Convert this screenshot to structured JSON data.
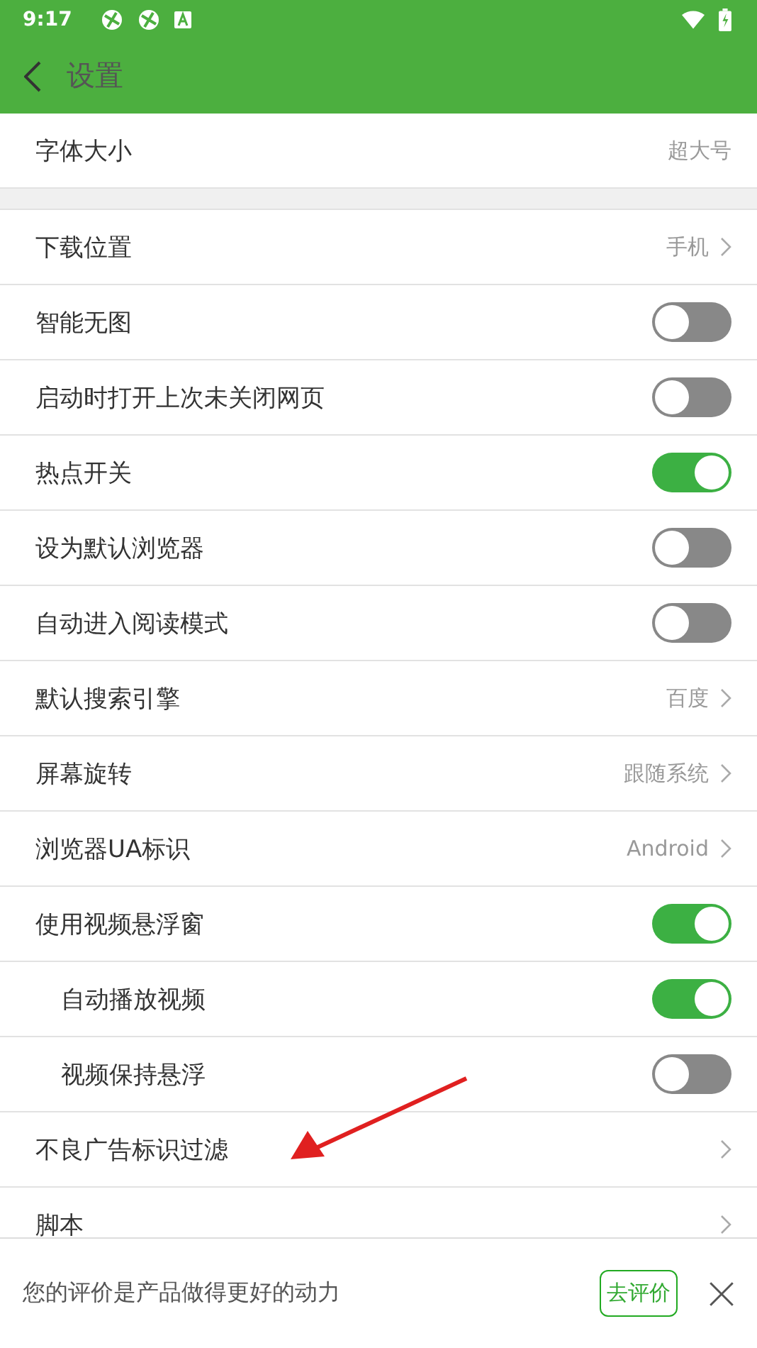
{
  "status_bar": {
    "time": "9:17"
  },
  "header": {
    "title": "设置"
  },
  "sections": [
    [
      {
        "kind": "text",
        "label": "字体大小",
        "value": "超大号"
      }
    ],
    [
      {
        "kind": "link",
        "label": "下载位置",
        "value": "手机"
      },
      {
        "kind": "toggle",
        "label": "智能无图",
        "on": false
      },
      {
        "kind": "toggle",
        "label": "启动时打开上次未关闭网页",
        "on": false
      },
      {
        "kind": "toggle",
        "label": "热点开关",
        "on": true
      },
      {
        "kind": "toggle",
        "label": "设为默认浏览器",
        "on": false
      },
      {
        "kind": "toggle",
        "label": "自动进入阅读模式",
        "on": false
      },
      {
        "kind": "link",
        "label": "默认搜索引擎",
        "value": "百度"
      },
      {
        "kind": "link",
        "label": "屏幕旋转",
        "value": "跟随系统"
      },
      {
        "kind": "link",
        "label": "浏览器UA标识",
        "value": "Android"
      },
      {
        "kind": "toggle",
        "label": "使用视频悬浮窗",
        "on": true,
        "children": [
          {
            "kind": "toggle",
            "label": "自动播放视频",
            "on": true
          },
          {
            "kind": "toggle",
            "label": "视频保持悬浮",
            "on": false
          }
        ]
      },
      {
        "kind": "nav",
        "label": "不良广告标识过滤"
      },
      {
        "kind": "nav",
        "label": "脚本"
      }
    ]
  ],
  "rating_bar": {
    "text": "您的评价是产品做得更好的动力",
    "button": "去评价"
  }
}
